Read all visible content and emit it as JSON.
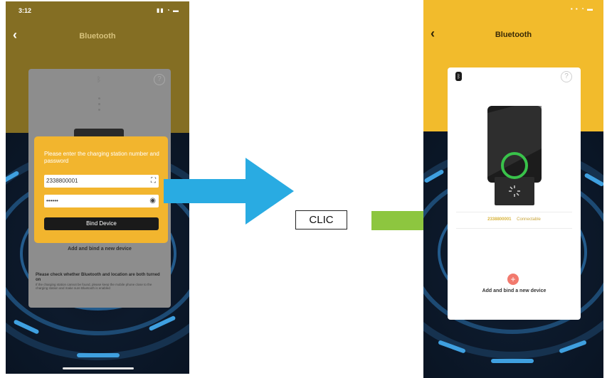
{
  "left_phone": {
    "status_time": "3:12",
    "nav_title": "Bluetooth",
    "dialog": {
      "prompt": "Please enter the charging station number and password",
      "number_value": "2338800001",
      "password_value": "••••••",
      "bind_label": "Bind Device"
    },
    "background_sheet": {
      "add_label": "Add and bind a new device",
      "warning_title": "Please check whether Bluetooth and location are both turned on",
      "warning_body": "If the charging station cannot be found, please keep the mobile phone close to the charging station and make sure Bluetooth is enabled"
    }
  },
  "center": {
    "clic_label": "CLIC",
    "arrow_left_color": "#29abe2",
    "arrow_right_color": "#8dc63f"
  },
  "right_phone": {
    "nav_title": "Bluetooth",
    "device_id": "2338800001",
    "device_status": "Connectable",
    "add_label": "Add and bind a new device",
    "ring_color": "#39c24a",
    "header_color": "#f2bb2c"
  }
}
